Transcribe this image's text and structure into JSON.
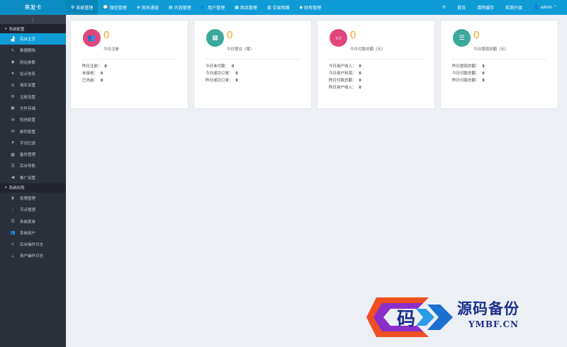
{
  "topbar": {
    "brand": "来发卡",
    "nav": [
      {
        "label": "系统管理",
        "icon": "⚙"
      },
      {
        "label": "微信管理",
        "icon": "💬"
      },
      {
        "label": "网关通道",
        "icon": "⊕"
      },
      {
        "label": "内容管理",
        "icon": "▤"
      },
      {
        "label": "用户管理",
        "icon": "👥"
      },
      {
        "label": "商品管理",
        "icon": "▦"
      },
      {
        "label": "交易明细",
        "icon": "▥"
      },
      {
        "label": "财务管理",
        "icon": "◆"
      }
    ],
    "refresh_icon": "⟳",
    "home": "首页",
    "clear_cache": "清除缓存",
    "check_update": "检测升级",
    "admin": "admin"
  },
  "sidebar": {
    "toggle_icon": "⋮",
    "groups": [
      {
        "title": "系统配置",
        "items": [
          {
            "label": "后台主页",
            "icon": "▟"
          },
          {
            "label": "数据删除",
            "icon": "✎"
          },
          {
            "label": "网站参数",
            "icon": "◉"
          },
          {
            "label": "站点信息",
            "icon": "●"
          },
          {
            "label": "域名设置",
            "icon": "⊘"
          },
          {
            "label": "注册设置",
            "icon": "⚙"
          },
          {
            "label": "文件存储",
            "icon": "▣"
          },
          {
            "label": "短信配置",
            "icon": "✉"
          },
          {
            "label": "邮件配置",
            "icon": "✉"
          },
          {
            "label": "字词过滤",
            "icon": "▼"
          },
          {
            "label": "备份管理",
            "icon": "▦"
          },
          {
            "label": "后台导航",
            "icon": "☰"
          },
          {
            "label": "推广设置",
            "icon": "◀"
          }
        ]
      },
      {
        "title": "系统权限",
        "items": [
          {
            "label": "权限管理",
            "icon": "♜"
          },
          {
            "label": "节点管理",
            "icon": "⋮"
          },
          {
            "label": "系统菜单",
            "icon": "☰"
          },
          {
            "label": "系统用户",
            "icon": "👥"
          },
          {
            "label": "后台操作日志",
            "icon": "≥"
          },
          {
            "label": "商户操作日志",
            "icon": "⊥"
          }
        ]
      }
    ]
  },
  "cards": [
    {
      "value": "0",
      "title": "今日注册",
      "color": "#e0457b",
      "icon": "👥",
      "stats": [
        {
          "label": "昨日注册：",
          "value": "0"
        },
        {
          "label": "未审核：",
          "value": "0"
        },
        {
          "label": "已冻结：",
          "value": "0"
        }
      ]
    },
    {
      "value": "0",
      "title": "今日提交（笔）",
      "color": "#3aa99a",
      "icon": "▦",
      "stats": [
        {
          "label": "今日未付款：",
          "value": "0"
        },
        {
          "label": "今日成功订单：",
          "value": "0"
        },
        {
          "label": "昨日成功订单：",
          "value": "0"
        }
      ]
    },
    {
      "value": "0",
      "title": "今日付款总额（元）",
      "color": "#e0457b",
      "icon": "▭",
      "stats": [
        {
          "label": "今日用户收入：",
          "value": "0"
        },
        {
          "label": "今日用户利润：",
          "value": "0"
        },
        {
          "label": "昨日付款总额：",
          "value": "0"
        },
        {
          "label": "昨日用户收入：",
          "value": "0"
        }
      ]
    },
    {
      "value": "0",
      "title": "今日提现总额（元）",
      "color": "#3aa99a",
      "icon": "☰",
      "stats": [
        {
          "label": "昨日提现总额：",
          "value": "0"
        },
        {
          "label": "今日付款总额：",
          "value": "0"
        },
        {
          "label": "昨日付款总额：",
          "value": "0"
        }
      ]
    }
  ],
  "watermark": {
    "logo_char": "码",
    "cn": "源码备份",
    "en": "YMBF.CN"
  },
  "colors": {
    "topbar": "#0e9bd6",
    "sidebar": "#2b2f3a",
    "accent_number": "#f5a623"
  }
}
